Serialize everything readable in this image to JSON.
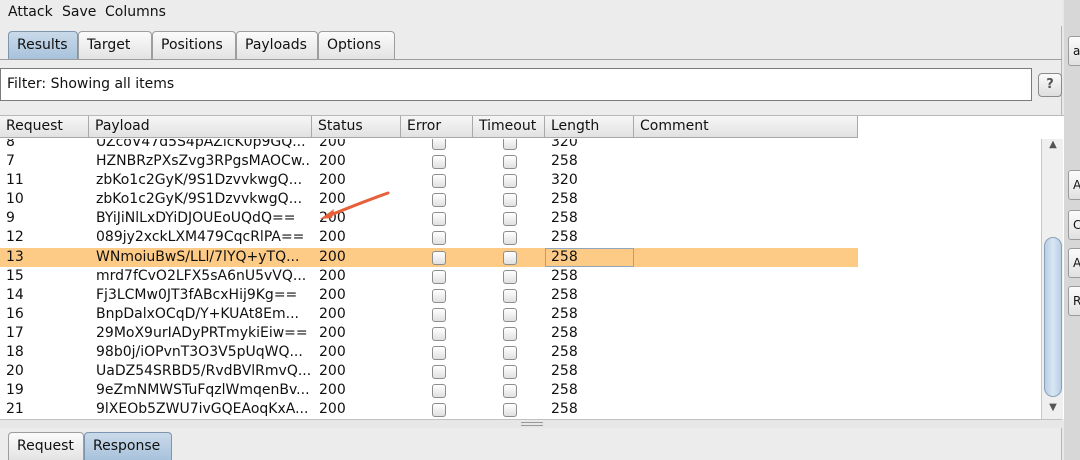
{
  "menu": {
    "attack": "Attack",
    "save": "Save",
    "columns": "Columns"
  },
  "tabs": {
    "results": "Results",
    "target": "Target",
    "positions": "Positions",
    "payloads": "Payloads",
    "options": "Options"
  },
  "filter": {
    "text": "Filter: Showing all items"
  },
  "help_label": "?",
  "columns": {
    "request": "Request",
    "payload": "Payload",
    "status": "Status",
    "error": "Error",
    "timeout": "Timeout",
    "length": "Length",
    "comment": "Comment"
  },
  "rows": [
    {
      "request": "8",
      "payload": "UZcoV47d5S4pAZlcK0p9GQ...",
      "status": "200",
      "length": "320"
    },
    {
      "request": "7",
      "payload": "HZNBRzPXsZvg3RPgsMAOCw...",
      "status": "200",
      "length": "258"
    },
    {
      "request": "11",
      "payload": "zbKo1c2GyK/9S1DzvvkwgQ...",
      "status": "200",
      "length": "320"
    },
    {
      "request": "10",
      "payload": "zbKo1c2GyK/9S1DzvvkwgQ...",
      "status": "200",
      "length": "258"
    },
    {
      "request": "9",
      "payload": "BYiJiNlLxDYiDJOUEoUQdQ==",
      "status": "200",
      "length": "258"
    },
    {
      "request": "12",
      "payload": "089jy2xckLXM479CqcRlPA==",
      "status": "200",
      "length": "258"
    },
    {
      "request": "13",
      "payload": "WNmoiuBwS/LLl/7lYQ+yTQ...",
      "status": "200",
      "length": "258"
    },
    {
      "request": "15",
      "payload": "mrd7fCvO2LFX5sA6nU5vVQ...",
      "status": "200",
      "length": "258"
    },
    {
      "request": "14",
      "payload": "Fj3LCMw0JT3fABcxHij9Kg==",
      "status": "200",
      "length": "258"
    },
    {
      "request": "16",
      "payload": "BnpDalxOCqD/Y+KUAt8Em...",
      "status": "200",
      "length": "258"
    },
    {
      "request": "17",
      "payload": "29MoX9urIADyPRTmykiEiw==",
      "status": "200",
      "length": "258"
    },
    {
      "request": "18",
      "payload": "98b0j/iOPvnT3O3V5pUqWQ...",
      "status": "200",
      "length": "258"
    },
    {
      "request": "20",
      "payload": "UaDZ54SRBD5/RvdBVlRmvQ...",
      "status": "200",
      "length": "258"
    },
    {
      "request": "19",
      "payload": "9eZmNMWSTuFqzlWmqenBv...",
      "status": "200",
      "length": "258"
    },
    {
      "request": "21",
      "payload": "9lXEOb5ZWU7ivGQEAoqKxA...",
      "status": "200",
      "length": "258"
    }
  ],
  "selected_row": "13",
  "bottom_tabs": {
    "request": "Request",
    "response": "Response"
  },
  "right_strip": [
    "a",
    "A",
    "C",
    "A",
    "R"
  ],
  "colors": {
    "selected_row": "#fdcb85",
    "active_tab": "#a8c2dc",
    "arrow": "#e8603a"
  },
  "icons": {
    "scroll_up": "chevron-up-icon",
    "scroll_down": "chevron-down-icon",
    "annotation": "arrow-annotation-icon"
  }
}
